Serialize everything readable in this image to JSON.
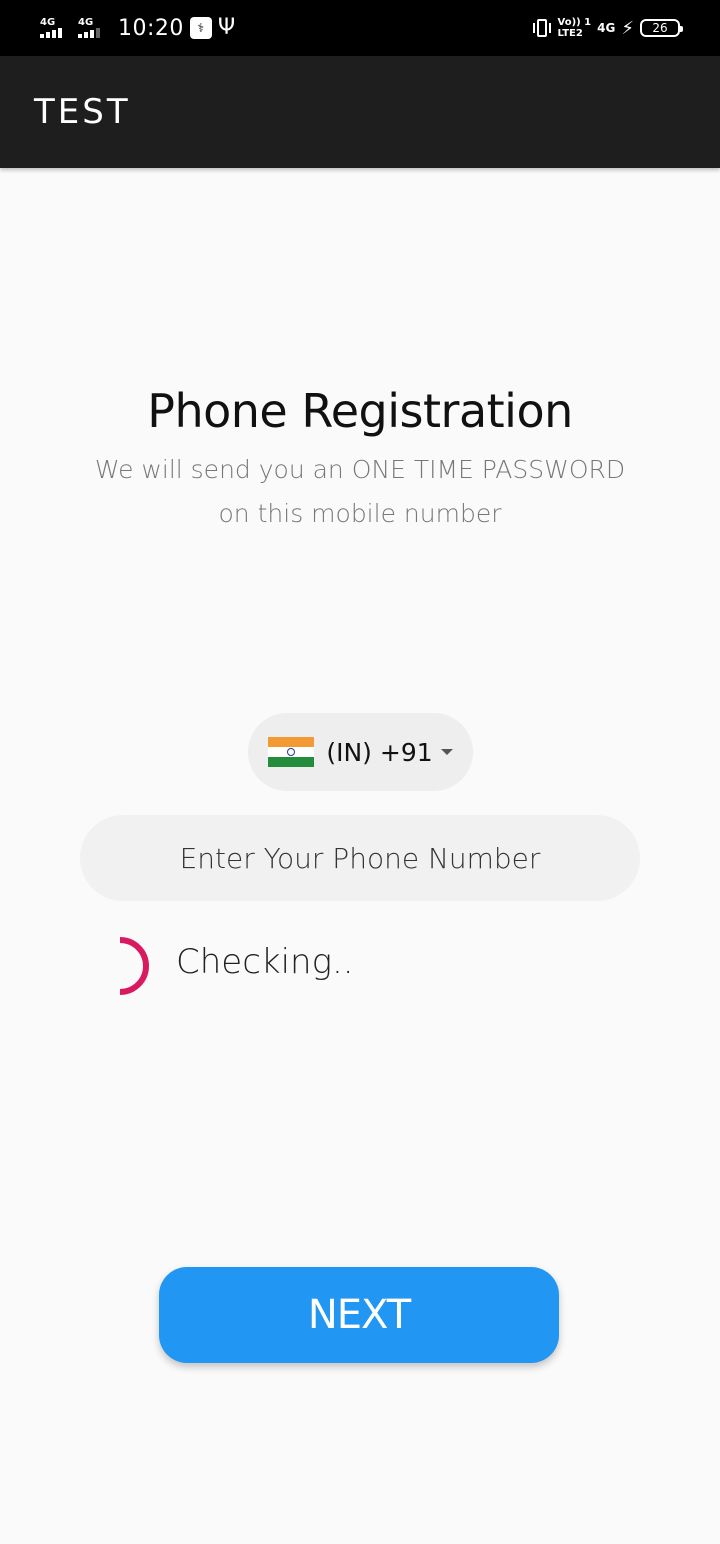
{
  "status_bar": {
    "sim1_network": "4G",
    "sim2_network": "4G",
    "time": "10:20",
    "volte_line1": "Vo)) 1",
    "volte_line2": "LTE2",
    "data_network": "4G",
    "battery": "26",
    "icons": [
      "signal-icon",
      "usb-debug-icon",
      "usb-icon",
      "vibrate-icon",
      "charging-icon",
      "battery-icon"
    ]
  },
  "app_bar": {
    "title": "TEST"
  },
  "registration": {
    "heading": "Phone Registration",
    "subtitle_line1": "We will send you an ONE TIME PASSWORD",
    "subtitle_line2": "on this mobile number"
  },
  "country_picker": {
    "flag": "india-flag-icon",
    "code": "(IN) +91"
  },
  "phone_input": {
    "value": "",
    "placeholder": "Enter Your Phone Number"
  },
  "progress": {
    "label": "Checking.."
  },
  "next_button": {
    "label": "NEXT"
  },
  "colors": {
    "app_bar": "#1e1e1e",
    "background": "#fafafa",
    "accent": "#2196f3",
    "spinner": "#d81b60"
  }
}
